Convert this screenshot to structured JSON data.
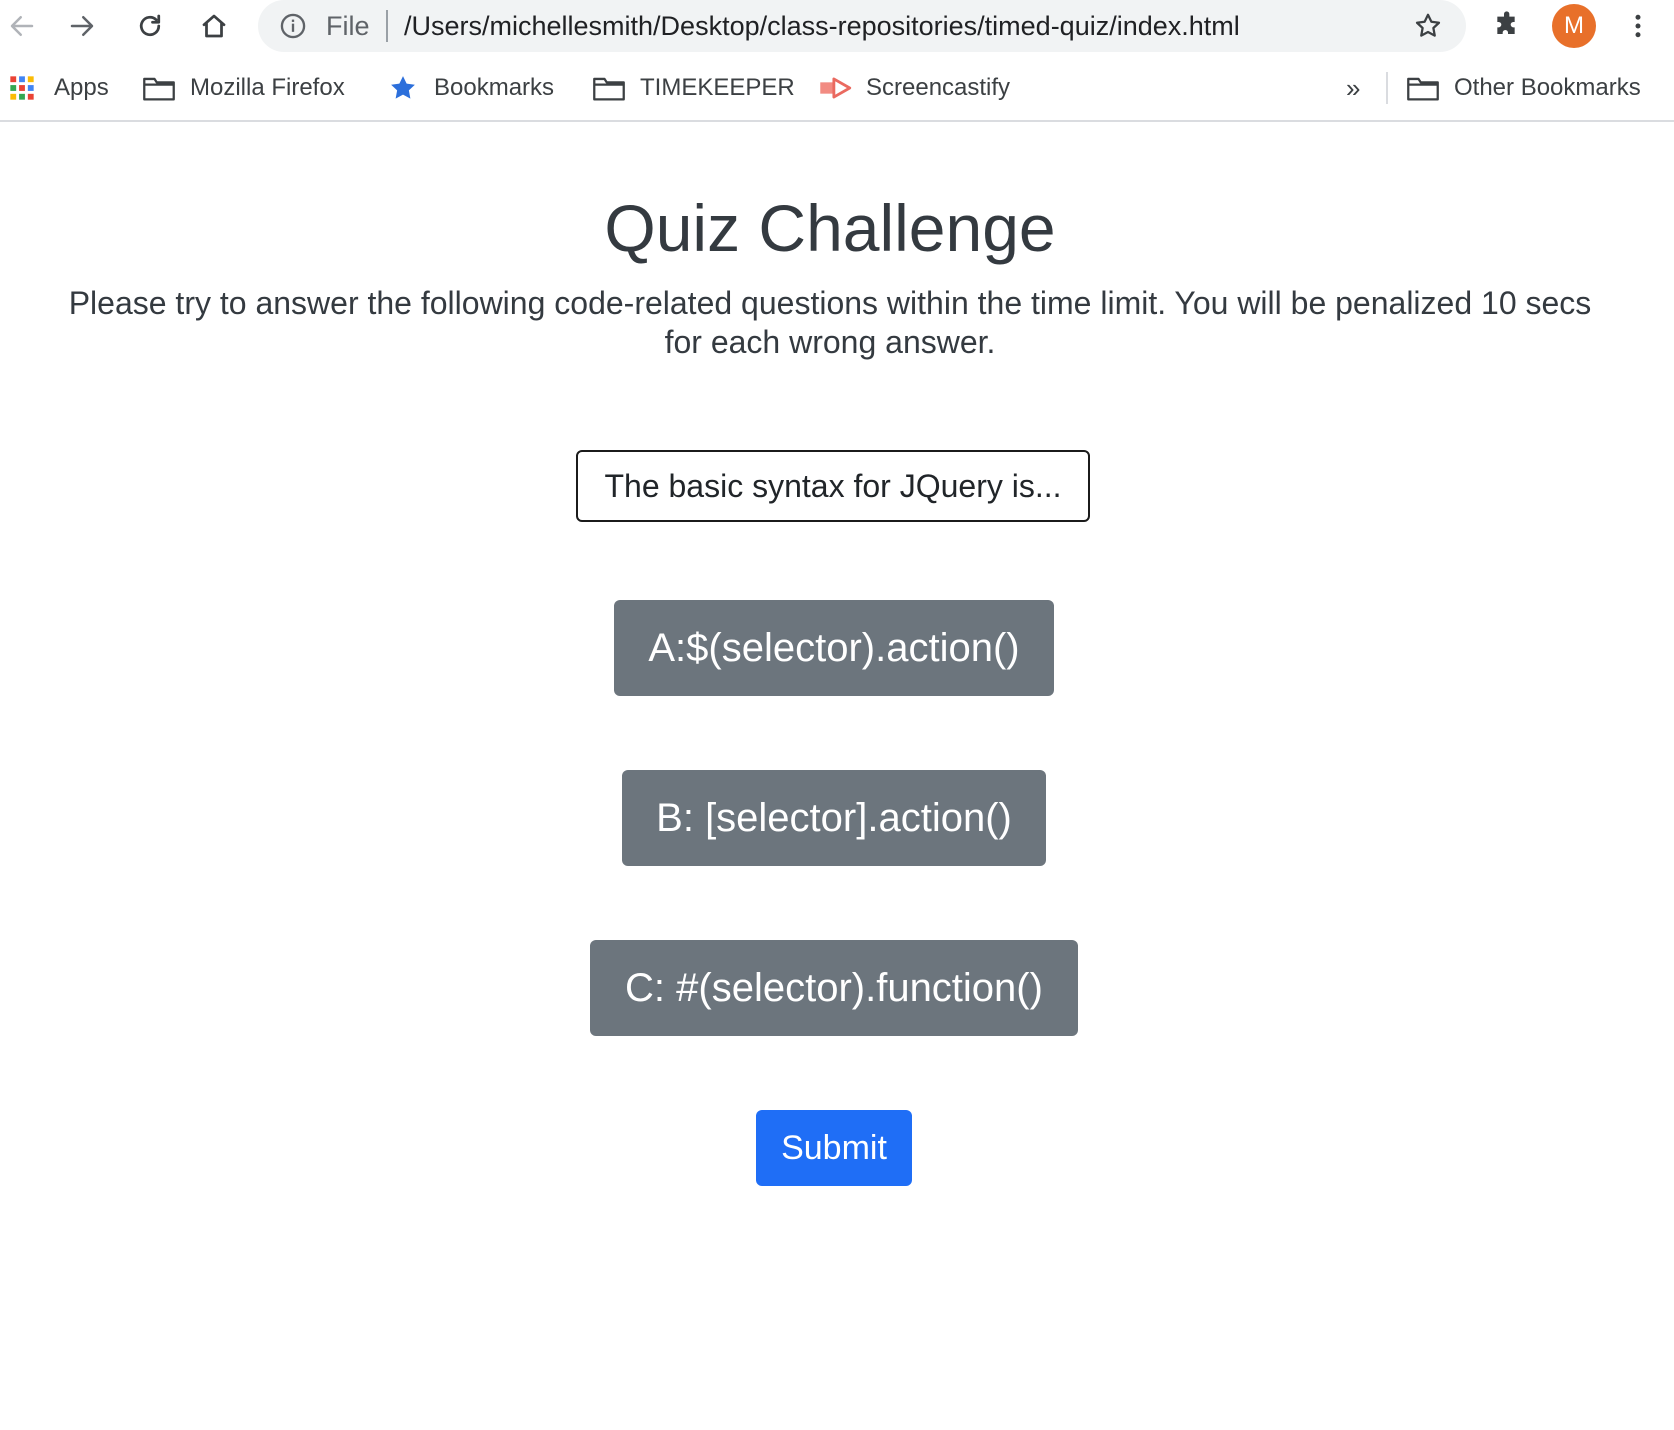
{
  "browser": {
    "omnibox": {
      "scheme": "File",
      "url": "/Users/michellesmith/Desktop/class-repositories/timed-quiz/index.html"
    },
    "profile_initial": "M",
    "colors": {
      "avatar": "#e8702a",
      "toolbar_icon": "#5f6368"
    }
  },
  "bookmarks": {
    "items": [
      {
        "label": "Apps",
        "icon": "apps-grid-icon"
      },
      {
        "label": "Mozilla Firefox",
        "icon": "folder-icon"
      },
      {
        "label": "Bookmarks",
        "icon": "star-icon"
      },
      {
        "label": "TIMEKEEPER",
        "icon": "folder-icon"
      },
      {
        "label": "Screencastify",
        "icon": "screencastify-icon"
      }
    ],
    "overflow_label": "»",
    "other_label": "Other Bookmarks"
  },
  "page": {
    "title": "Quiz Challenge",
    "intro": "Please try to answer the following code-related questions within the time limit. You will be penalized 10 secs for each wrong answer.",
    "question": "The basic syntax for JQuery is...",
    "answers": [
      {
        "label": "A:$(selector).action()"
      },
      {
        "label": "B: [selector].action()"
      },
      {
        "label": "C: #(selector).function()"
      }
    ],
    "submit_label": "Submit",
    "colors": {
      "text": "#343a40",
      "answer_button": "#6c757d",
      "submit_button": "#1f6ef6"
    }
  }
}
